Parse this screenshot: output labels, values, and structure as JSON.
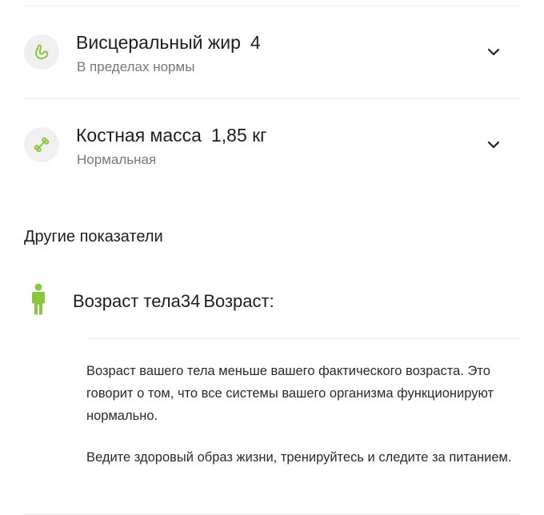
{
  "metrics": [
    {
      "title": "Висцеральный жир",
      "value": "4",
      "status": "В пределах нормы",
      "icon": "visceral-fat-icon"
    },
    {
      "title": "Костная масса",
      "value": "1,85 кг",
      "status": "Нормальная",
      "icon": "bone-icon"
    }
  ],
  "other_section": {
    "title": "Другие показатели"
  },
  "body_age": {
    "label": "Возраст тела",
    "value": "34",
    "suffix": "Возраст:",
    "icon": "person-icon",
    "description_1": "Возраст вашего тела меньше вашего фактического возраста. Это говорит о том, что все системы вашего организма функционируют нормально.",
    "description_2": "Ведите здоровый образ жизни, тренируйтесь и следите за питанием."
  },
  "colors": {
    "accent_green": "#8cc63f",
    "icon_bg": "#f0f0f0",
    "divider": "#ececec",
    "secondary_text": "#777777"
  }
}
